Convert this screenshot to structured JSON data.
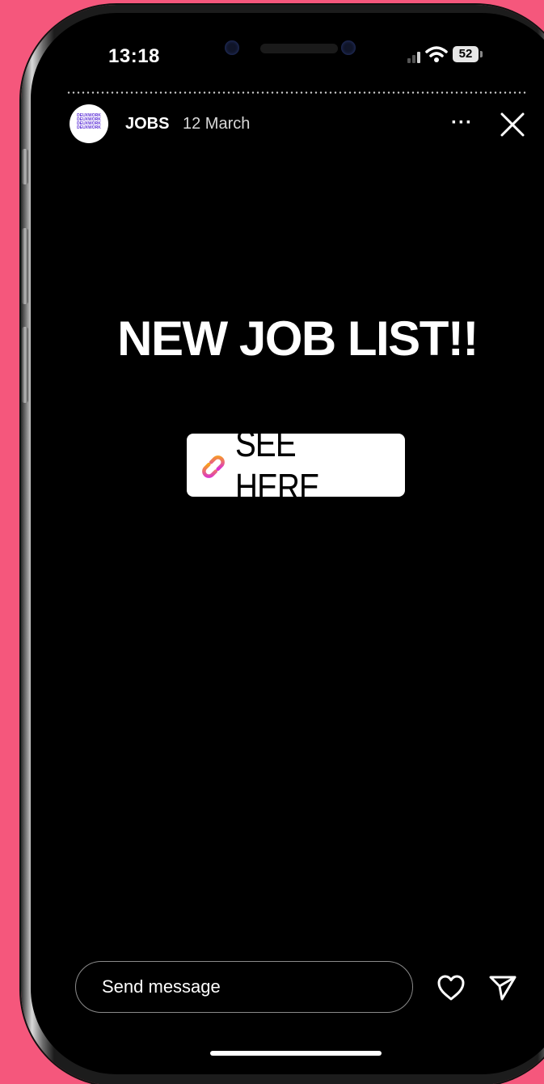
{
  "status_bar": {
    "time": "13:18",
    "battery": "52"
  },
  "story": {
    "avatar_lines": [
      "DEUXWORK",
      "DEUXWORK",
      "DEUXWORK",
      "DEUXWORK"
    ],
    "username": "JOBS",
    "date": "12 March",
    "more_label": "···",
    "headline": "NEW JOB LIST!!",
    "link_sticker": {
      "label": "SEE HERE"
    }
  },
  "footer": {
    "message_placeholder": "Send message"
  },
  "icons": {
    "signal": "signal-icon",
    "wifi": "wifi-icon",
    "battery": "battery-icon",
    "more": "more-icon",
    "close": "close-icon",
    "link": "link-icon",
    "like": "heart-icon",
    "share": "send-icon"
  },
  "colors": {
    "background": "#f5577c",
    "screen": "#000000",
    "text": "#ffffff",
    "link_gradient_start": "#f9a11b",
    "link_gradient_end": "#d92ed6"
  }
}
